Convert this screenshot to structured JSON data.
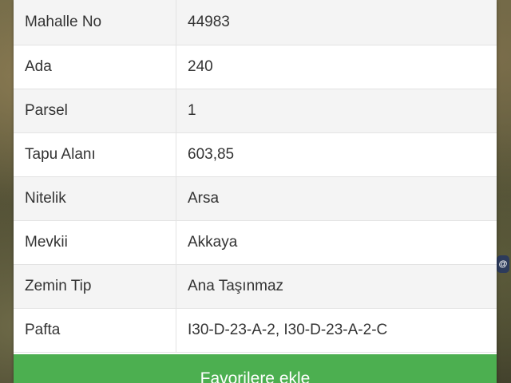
{
  "map": {
    "badge_label": "@"
  },
  "parcel_info": {
    "rows": [
      {
        "key": "Mahalle No",
        "value": "44983"
      },
      {
        "key": "Ada",
        "value": "240"
      },
      {
        "key": "Parsel",
        "value": "1"
      },
      {
        "key": "Tapu Alanı",
        "value": "603,85"
      },
      {
        "key": "Nitelik",
        "value": "Arsa"
      },
      {
        "key": "Mevkii",
        "value": "Akkaya"
      },
      {
        "key": "Zemin Tip",
        "value": "Ana Taşınmaz"
      },
      {
        "key": "Pafta",
        "value": "I30-D-23-A-2, I30-D-23-A-2-C"
      }
    ]
  },
  "actions": {
    "favorite_label": "Favorilere ekle",
    "favorite_color": "#4caf50"
  }
}
